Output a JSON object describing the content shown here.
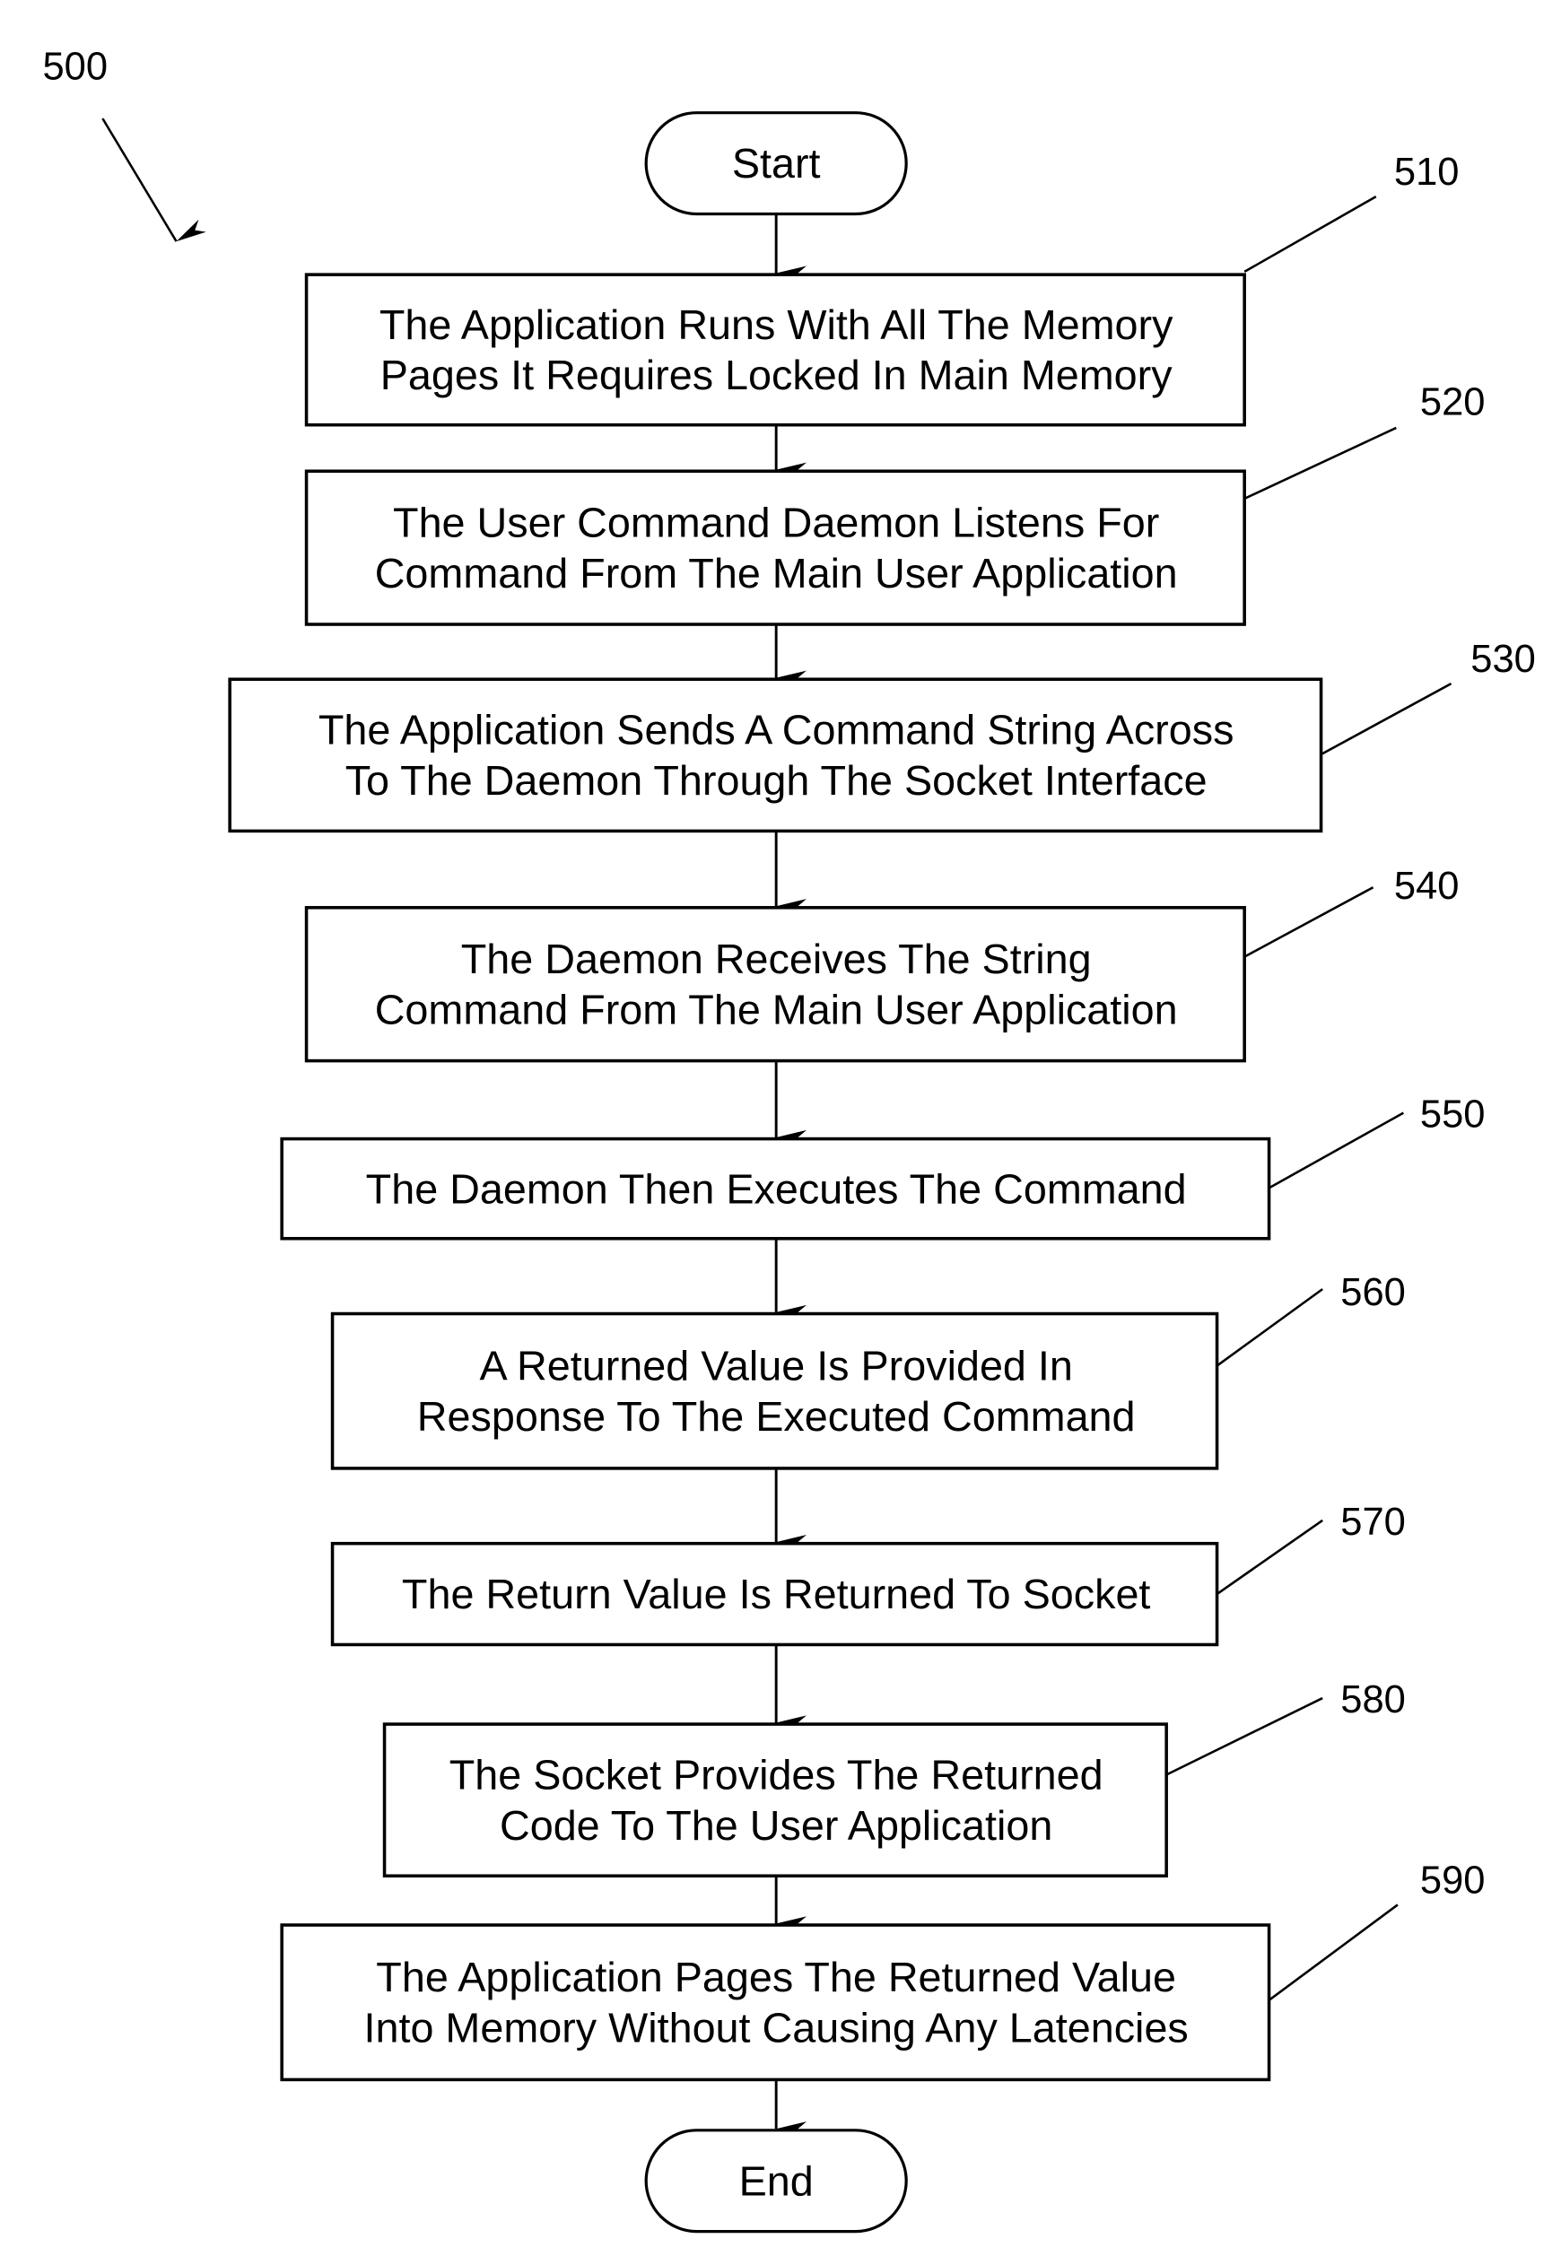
{
  "figure": {
    "reference_label": "500",
    "start_label": "Start",
    "end_label": "End",
    "steps": [
      {
        "ref": "510",
        "lines": [
          "The Application Runs With All The Memory",
          "Pages It Requires Locked In Main Memory"
        ]
      },
      {
        "ref": "520",
        "lines": [
          "The User Command Daemon Listens For",
          "Command From The Main User Application"
        ]
      },
      {
        "ref": "530",
        "lines": [
          "The Application Sends A Command String Across",
          "To The Daemon Through The Socket Interface"
        ]
      },
      {
        "ref": "540",
        "lines": [
          "The Daemon Receives The String",
          "Command From The Main User Application"
        ]
      },
      {
        "ref": "550",
        "lines": [
          "The Daemon Then Executes The Command"
        ]
      },
      {
        "ref": "560",
        "lines": [
          "A Returned Value Is Provided In",
          "Response To The Executed Command"
        ]
      },
      {
        "ref": "570",
        "lines": [
          "The Return Value Is Returned To Socket"
        ]
      },
      {
        "ref": "580",
        "lines": [
          "The Socket Provides The Returned",
          "Code To The User Application"
        ]
      },
      {
        "ref": "590",
        "lines": [
          "The Application Pages The Returned Value",
          "Into Memory Without Causing Any Latencies"
        ]
      }
    ]
  }
}
